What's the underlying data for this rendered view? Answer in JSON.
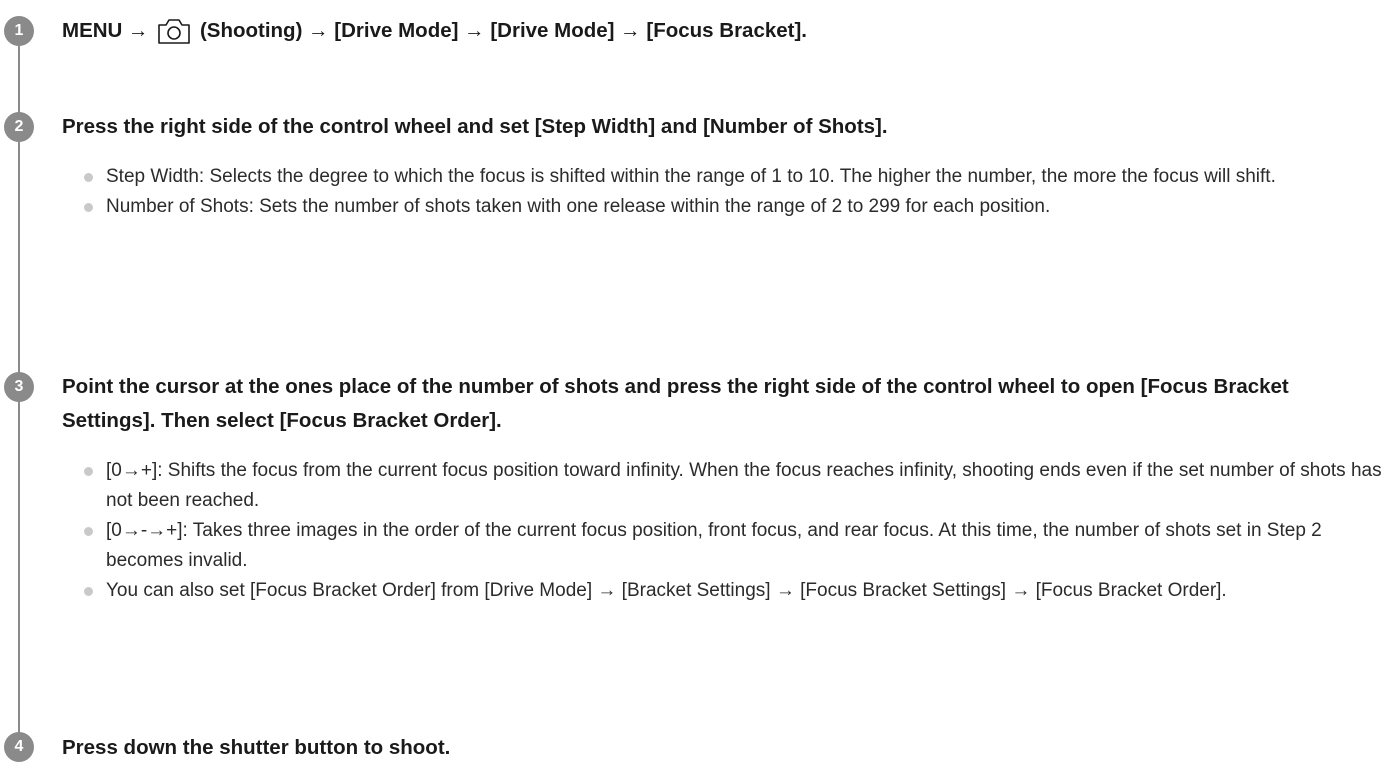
{
  "steps": [
    {
      "number": "1",
      "title_prefix": "MENU → ",
      "title_icon": "camera-icon",
      "title_suffix": " (Shooting) → [Drive Mode] → [Drive Mode] → [Focus Bracket].",
      "bullets": []
    },
    {
      "number": "2",
      "title": "Press the right side of the control wheel and set [Step Width] and [Number of Shots].",
      "bullets": [
        "Step Width: Selects the degree to which the focus is shifted within the range of 1 to 10. The higher the number, the more the focus will shift.",
        "Number of Shots: Sets the number of shots taken with one release within the range of 2 to 299 for each position."
      ]
    },
    {
      "number": "3",
      "title": "Point the cursor at the ones place of the number of shots and press the right side of the control wheel to open [Focus Bracket Settings]. Then select [Focus Bracket Order].",
      "bullets": [
        "[0→+]: Shifts the focus from the current focus position toward infinity. When the focus reaches infinity, shooting ends even if the set number of shots has not been reached.",
        "[0→-→+]: Takes three images in the order of the current focus position, front focus, and rear focus. At this time, the number of shots set in Step 2 becomes invalid.",
        "You can also set [Focus Bracket Order] from [Drive Mode] → [Bracket Settings] → [Focus Bracket Settings] → [Focus Bracket Order]."
      ]
    },
    {
      "number": "4",
      "title": "Press down the shutter button to shoot.",
      "bullets": []
    }
  ],
  "colors": {
    "step_circle": "#8a8a8a",
    "timeline": "#8a8a8a",
    "bullet_dot": "#c9c9c9",
    "text": "#1a1a1a"
  }
}
